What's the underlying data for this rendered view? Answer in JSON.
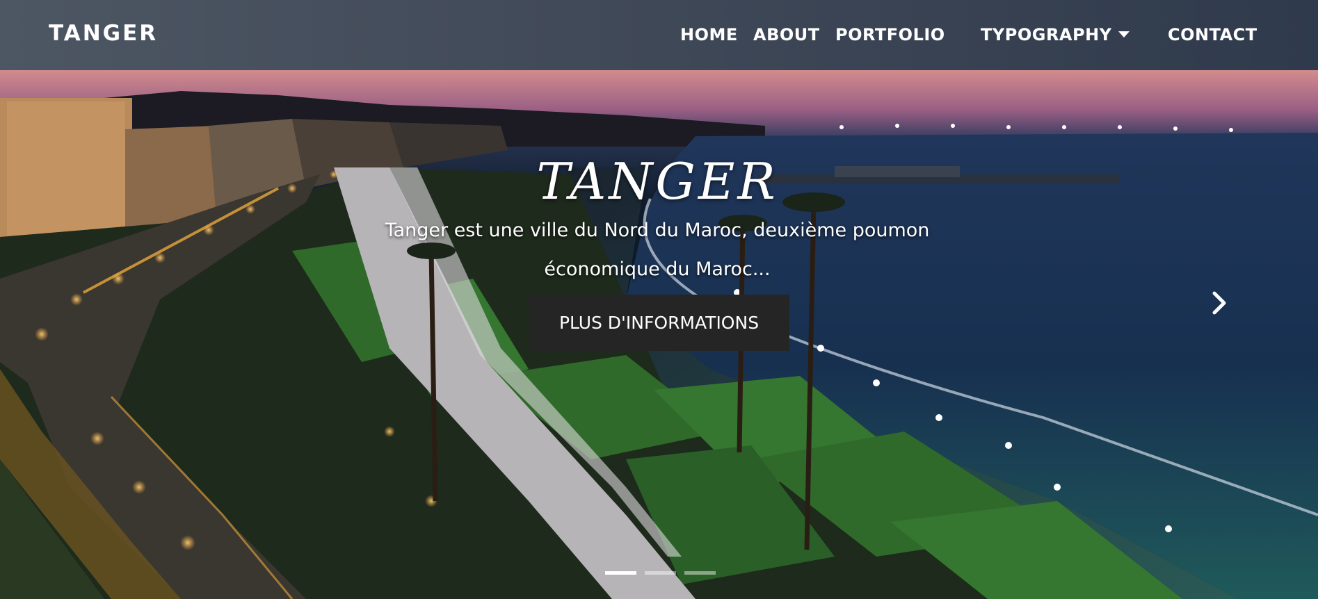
{
  "brand": "TANGER",
  "nav": {
    "home": "HOME",
    "about": "ABOUT",
    "portfolio": "PORTFOLIO",
    "typography": "TYPOGRAPHY",
    "contact": "CONTACT"
  },
  "carousel": {
    "title": "TANGER",
    "text_line1": "Tanger est une ville du Nord du Maroc, deuxième poumon",
    "text_line2": "économique du Maroc...",
    "button": "PLUS D'INFORMATIONS",
    "slide_count": 3,
    "active_slide": 1
  },
  "icons": {
    "dropdown": "caret-down-icon",
    "next": "chevron-right-icon"
  },
  "colors": {
    "nav_background": "#434c5a",
    "button_background": "#252526",
    "text": "#ffffff"
  }
}
